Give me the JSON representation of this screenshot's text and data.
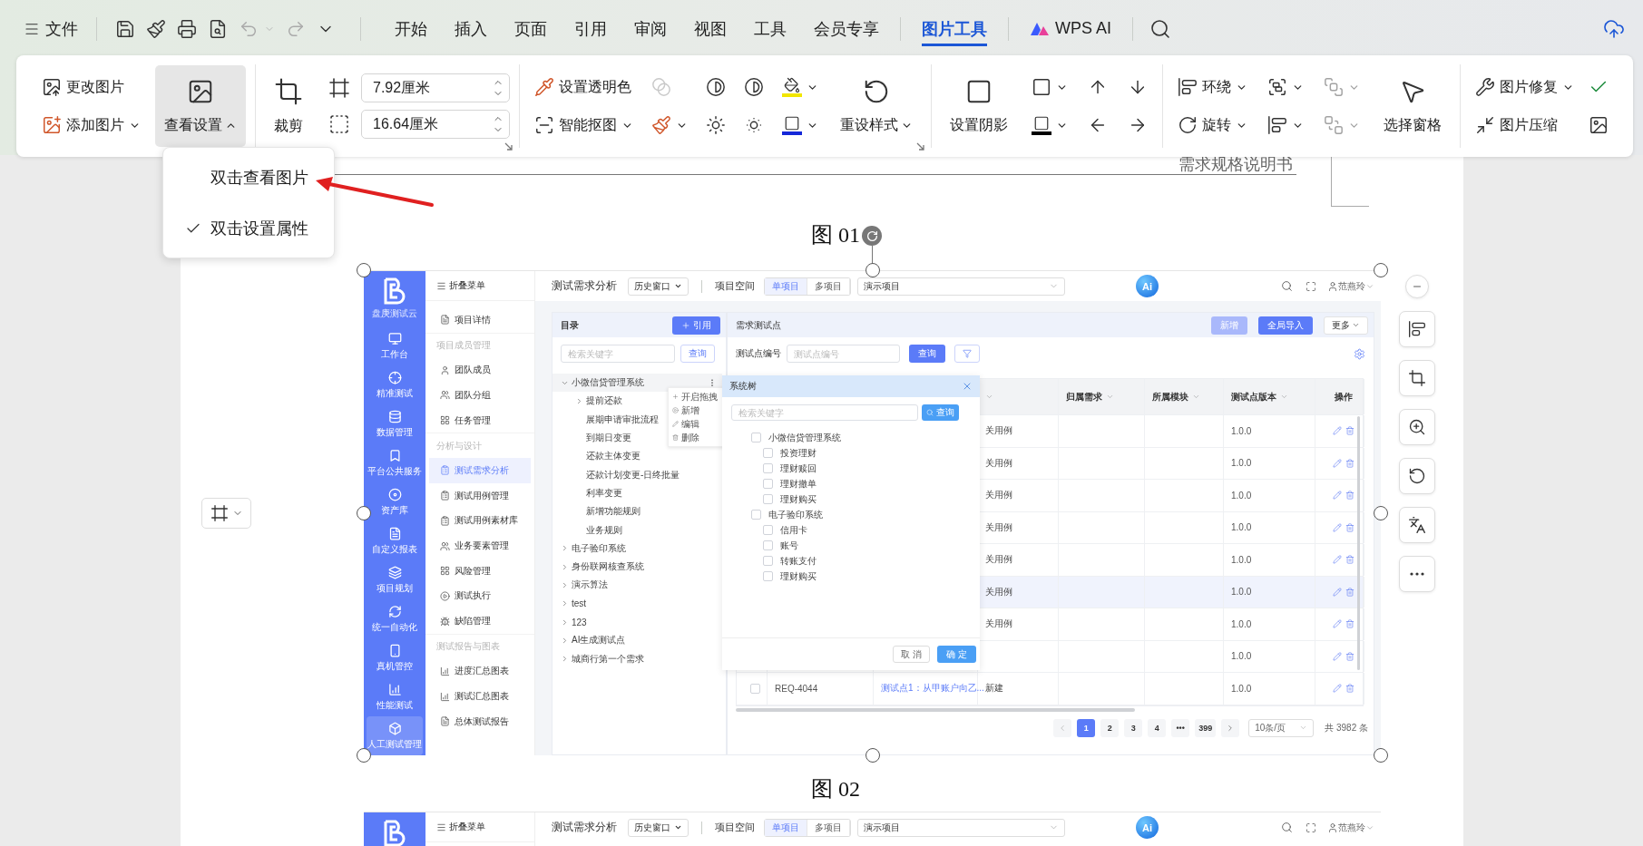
{
  "menu_bar": {
    "file": "文件"
  },
  "tabs": [
    {
      "label": "开始",
      "kind": "plain",
      "selected": false
    },
    {
      "label": "插入",
      "kind": "plain",
      "selected": false
    },
    {
      "label": "页面",
      "kind": "plain",
      "selected": false
    },
    {
      "label": "引用",
      "kind": "plain",
      "selected": false
    },
    {
      "label": "审阅",
      "kind": "plain",
      "selected": false
    },
    {
      "label": "视图",
      "kind": "plain",
      "selected": false
    },
    {
      "label": "工具",
      "kind": "plain",
      "selected": false
    },
    {
      "label": "会员专享",
      "kind": "plain",
      "selected": false
    },
    {
      "label": "图片工具",
      "kind": "plain",
      "selected": true
    },
    {
      "label": "WPS AI",
      "kind": "ai",
      "selected": false
    }
  ],
  "ribbon": {
    "change_picture": "更改图片",
    "add_picture": "添加图片",
    "view_settings": {
      "label": "查看设置",
      "expanded": true
    },
    "crop": "裁剪",
    "height": "7.92厘米",
    "width": "16.64厘米",
    "set_transparent": "设置透明色",
    "smart_cutout": "智能抠图",
    "reset_style": "重设样式",
    "set_shadow": "设置阴影",
    "wrap": "环绕",
    "rotate": "旋转",
    "selection_pane": "选择窗格",
    "picture_repair": "图片修复",
    "picture_compress": "图片压缩"
  },
  "view_menu": [
    {
      "label": "双击查看图片",
      "checked": false
    },
    {
      "label": "双击设置属性",
      "checked": true
    }
  ],
  "document": {
    "header": "需求规格说明书",
    "caption_1": "图 01",
    "caption_2": "图 02"
  },
  "figure_1": {
    "sidebar": {
      "brand": "盘庚测试云",
      "items": [
        {
          "label": "工作台",
          "selected": false
        },
        {
          "label": "精准测试",
          "selected": false
        },
        {
          "label": "数据管理",
          "selected": false
        },
        {
          "label": "平台公共服务",
          "selected": false
        },
        {
          "label": "资产库",
          "selected": false
        },
        {
          "label": "自定义报表",
          "selected": false
        },
        {
          "label": "项目规划",
          "selected": false
        },
        {
          "label": "统一自动化",
          "selected": false
        },
        {
          "label": "真机管控",
          "selected": false
        },
        {
          "label": "性能测试",
          "selected": false
        },
        {
          "label": "人工测试管理",
          "selected": true
        }
      ]
    },
    "nav": {
      "collapse_label": "折叠菜单",
      "groups": [
        {
          "items": [
            {
              "label": "项目详情",
              "selected": false
            }
          ]
        },
        {
          "title": "项目成员管理",
          "items": [
            {
              "label": "团队成员",
              "selected": false
            },
            {
              "label": "团队分组",
              "selected": false
            },
            {
              "label": "任务管理",
              "selected": false
            }
          ]
        },
        {
          "title": "分析与设计",
          "items": [
            {
              "label": "测试需求分析",
              "selected": true
            },
            {
              "label": "测试用例管理",
              "selected": false
            },
            {
              "label": "测试用例素材库",
              "selected": false
            },
            {
              "label": "业务要素管理",
              "selected": false
            },
            {
              "label": "风险管理",
              "selected": false
            },
            {
              "label": "测试执行",
              "selected": false
            },
            {
              "label": "缺陷管理",
              "selected": false
            }
          ]
        },
        {
          "title": "测试报告与图表",
          "items": [
            {
              "label": "进度汇总图表",
              "selected": false
            },
            {
              "label": "测试汇总图表",
              "selected": false
            },
            {
              "label": "总体测试报告",
              "selected": false
            }
          ]
        }
      ]
    },
    "header": {
      "page_title": "测试需求分析",
      "history": "历史窗口",
      "space_label": "项目空间",
      "modes": [
        {
          "label": "单项目",
          "selected": true
        },
        {
          "label": "多项目",
          "selected": false
        }
      ],
      "project": "演示项目",
      "ai_logo": "Ai",
      "user": "范燕玲"
    },
    "catalog": {
      "title": "目录",
      "add_button": "引用",
      "search_placeholder": "检索关键字",
      "search_button": "查询",
      "tree": [
        {
          "label": "小微信贷管理系统",
          "expanded": true,
          "selected": true,
          "children": [
            {
              "label": "提前还款",
              "expanded": false,
              "selected": false
            },
            {
              "label": "展期申请审批流程",
              "selected": false
            },
            {
              "label": "到期日变更",
              "selected": false
            },
            {
              "label": "还款主体变更",
              "selected": false
            },
            {
              "label": "还款计划变更-日终批量",
              "selected": false
            },
            {
              "label": "利率变更",
              "selected": false
            },
            {
              "label": "新增功能规则",
              "selected": false
            },
            {
              "label": "业务规则",
              "selected": false
            }
          ]
        },
        {
          "label": "电子验印系统",
          "expanded": false,
          "selected": false
        },
        {
          "label": "身份联网核查系统",
          "expanded": false,
          "selected": false
        },
        {
          "label": "演示算法",
          "expanded": false,
          "selected": false
        },
        {
          "label": "test",
          "expanded": false,
          "selected": false
        },
        {
          "label": "123",
          "expanded": false,
          "selected": false
        },
        {
          "label": "AI生成测试点",
          "expanded": false,
          "selected": false
        },
        {
          "label": "城商行第一个需求",
          "expanded": false,
          "selected": false
        }
      ],
      "context_menu": [
        "开启拖拽",
        "新增",
        "编辑",
        "删除"
      ]
    },
    "requirements": {
      "title": "需求测试点",
      "buttons": [
        {
          "label": "新增",
          "disabled": true
        },
        {
          "label": "全局导入",
          "disabled": false
        }
      ],
      "more": "更多",
      "filter_label": "测试点编号",
      "filter_placeholder": "测试点编号",
      "query": "查询",
      "columns": [
        {
          "label": "归属需求",
          "sortable": true
        },
        {
          "label": "所属模块",
          "sortable": true
        },
        {
          "label": "测试点版本",
          "sortable": true
        },
        {
          "label": "操作",
          "sortable": false
        }
      ],
      "rows": [
        {
          "status": "关用例",
          "version": "1.0.0",
          "selected": false
        },
        {
          "status": "关用例",
          "version": "1.0.0",
          "selected": false
        },
        {
          "status": "关用例",
          "version": "1.0.0",
          "selected": false
        },
        {
          "status": "关用例",
          "version": "1.0.0",
          "selected": false
        },
        {
          "status": "关用例",
          "version": "1.0.0",
          "selected": false
        },
        {
          "status": "关用例",
          "version": "1.0.0",
          "selected": true
        },
        {
          "status": "关用例",
          "version": "1.0.0",
          "selected": false
        },
        {
          "version": "1.0.0",
          "selected": false
        },
        {
          "id": "REQ-4044",
          "name": "测试点1：从甲账户向乙...",
          "status": "新建",
          "version": "1.0.0",
          "selected": false
        }
      ],
      "pagination": {
        "pages": [
          {
            "label": "1",
            "selected": true
          },
          {
            "label": "2",
            "selected": false
          },
          {
            "label": "3",
            "selected": false
          },
          {
            "label": "4",
            "selected": false
          },
          {
            "label": "•••",
            "selected": false
          },
          {
            "label": "399",
            "selected": false
          }
        ],
        "page_size": "10条/页",
        "total": "共 3982 条"
      }
    },
    "system_tree": {
      "title": "系统树",
      "search_placeholder": "检索关键字",
      "search_button": "查询",
      "tree": [
        {
          "label": "小微信贷管理系统",
          "checked": false,
          "children": [
            {
              "label": "投资理财",
              "checked": false
            },
            {
              "label": "理财赎回",
              "checked": false
            },
            {
              "label": "理财撤单",
              "checked": false
            },
            {
              "label": "理财购买",
              "checked": false
            }
          ]
        },
        {
          "label": "电子验印系统",
          "checked": false,
          "children": [
            {
              "label": "信用卡",
              "checked": false
            },
            {
              "label": "账号",
              "checked": false
            },
            {
              "label": "转账支付",
              "checked": false
            },
            {
              "label": "理财购买",
              "checked": false
            }
          ]
        }
      ],
      "cancel": "取 消",
      "confirm": "确 定"
    }
  },
  "figure_2": {
    "collapse_label": "折叠菜单",
    "header": {
      "page_title": "测试需求分析",
      "history": "历史窗口",
      "space_label": "项目空间",
      "modes": [
        {
          "label": "单项目",
          "selected": true
        },
        {
          "label": "多项目",
          "selected": false
        }
      ],
      "project": "演示项目",
      "ai_logo": "Ai",
      "user": "范燕玲"
    }
  }
}
